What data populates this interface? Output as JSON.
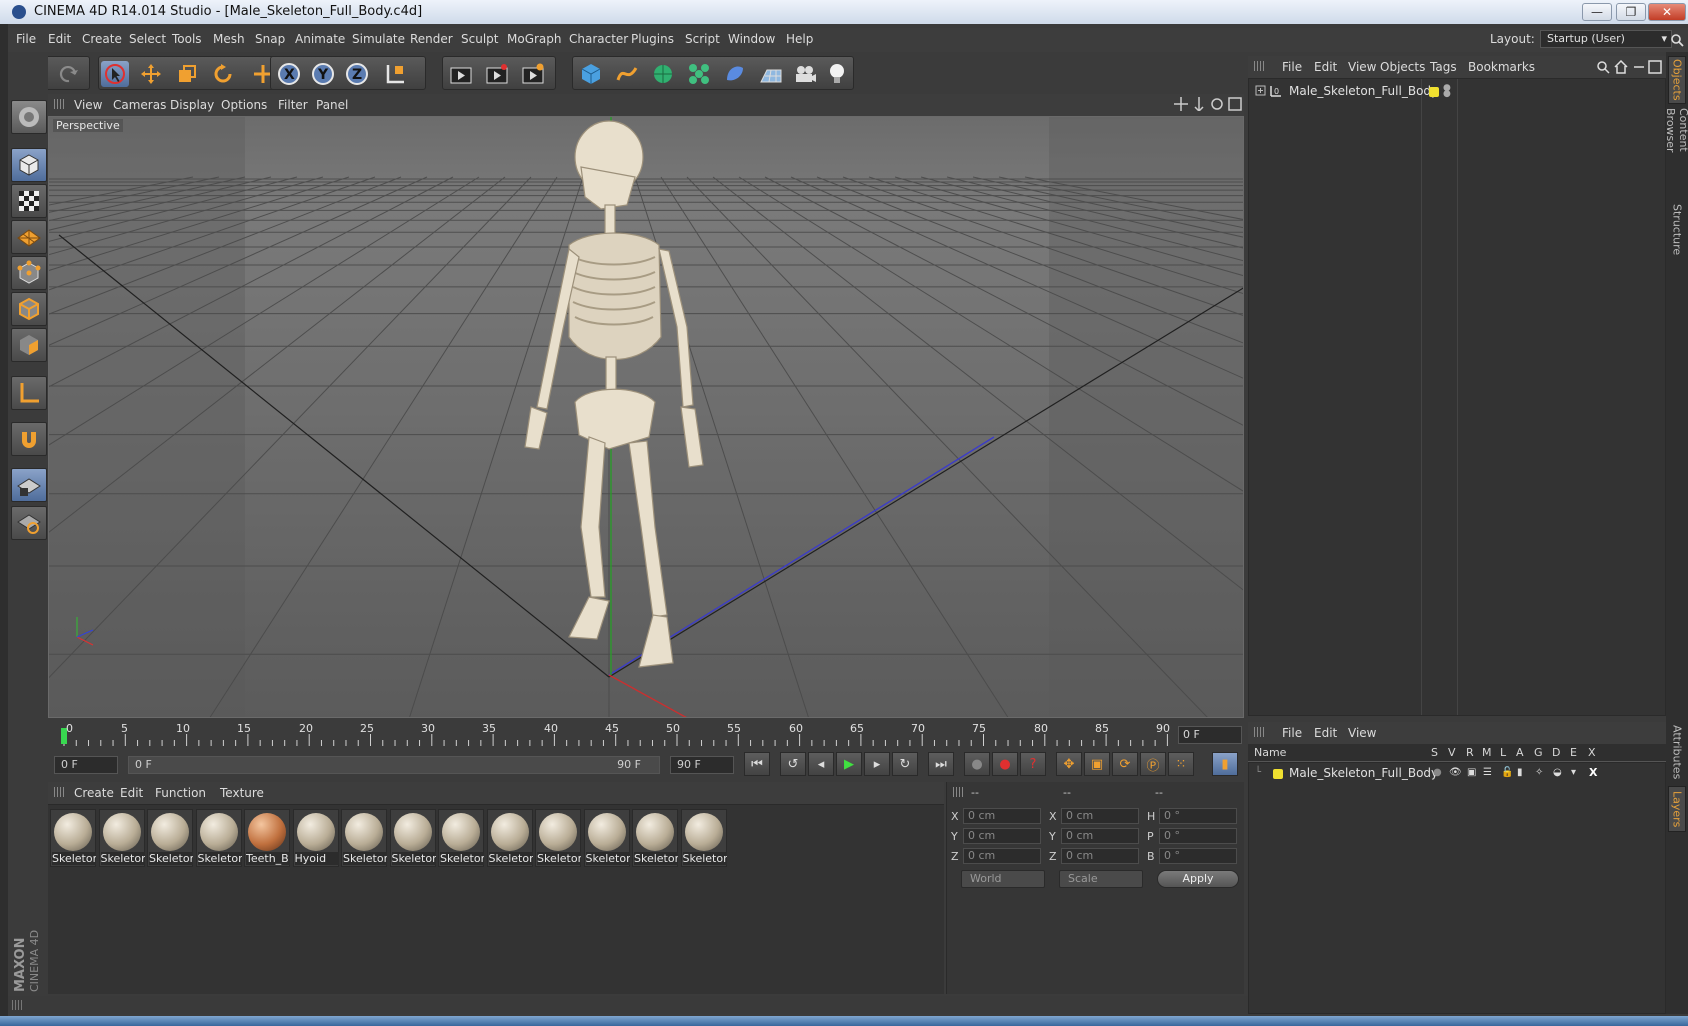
{
  "window": {
    "title": "CINEMA 4D R14.014 Studio - [Male_Skeleton_Full_Body.c4d]",
    "controls": [
      "—",
      "❐",
      "✕"
    ]
  },
  "menubar": {
    "items": [
      "File",
      "Edit",
      "Create",
      "Select",
      "Tools",
      "Mesh",
      "Snap",
      "Animate",
      "Simulate",
      "Render",
      "Sculpt",
      "MoGraph",
      "Character",
      "Plugins",
      "Script",
      "Window",
      "Help"
    ],
    "layout_label": "Layout:",
    "layout_value": "Startup (User)"
  },
  "viewport": {
    "menus": [
      "View",
      "Cameras",
      "Display",
      "Options",
      "Filter",
      "Panel"
    ],
    "camera_label": "Perspective"
  },
  "timeline": {
    "ticks": [
      "0",
      "5",
      "10",
      "15",
      "20",
      "25",
      "30",
      "35",
      "40",
      "45",
      "50",
      "55",
      "60",
      "65",
      "70",
      "75",
      "80",
      "85",
      "90"
    ],
    "current_frame": "0 F"
  },
  "transport": {
    "start_field": "0 F",
    "range_start": "0 F",
    "range_end": "90 F",
    "end_field": "90 F"
  },
  "materials": {
    "menus": [
      "Create",
      "Edit",
      "Function",
      "Texture"
    ],
    "items": [
      "Skeletor",
      "Skeletor",
      "Skeletor",
      "Skeletor",
      "Teeth_B",
      "Hyoid",
      "Skeletor",
      "Skeletor",
      "Skeletor",
      "Skeletor",
      "Skeletor",
      "Skeletor",
      "Skeletor",
      "Skeletor"
    ],
    "teeth_index": 4
  },
  "coordinates": {
    "headers": [
      "--",
      "--",
      "--"
    ],
    "rows": [
      {
        "a": "X",
        "av": "0 cm",
        "b": "X",
        "bv": "0 cm",
        "c": "H",
        "cv": "0 °"
      },
      {
        "a": "Y",
        "av": "0 cm",
        "b": "Y",
        "bv": "0 cm",
        "c": "P",
        "cv": "0 °"
      },
      {
        "a": "Z",
        "av": "0 cm",
        "b": "Z",
        "bv": "0 cm",
        "c": "B",
        "cv": "0 °"
      }
    ],
    "world": "World",
    "scale": "Scale",
    "apply": "Apply"
  },
  "objects": {
    "menus": [
      "File",
      "Edit",
      "View",
      "Objects",
      "Tags",
      "Bookmarks"
    ],
    "item": "Male_Skeleton_Full_Body",
    "layer_color": "#f0e030"
  },
  "layers": {
    "menus": [
      "File",
      "Edit",
      "View"
    ],
    "columns": [
      "Name",
      "S",
      "V",
      "R",
      "M",
      "L",
      "A",
      "G",
      "D",
      "E",
      "X"
    ],
    "item": "Male_Skeleton_Full_Body"
  },
  "right_tabs": [
    "Objects",
    "Content Browser",
    "Structure",
    "Attributes",
    "Layers"
  ],
  "branding": {
    "maxon": "MAXON",
    "product": "CINEMA 4D"
  },
  "colors": {
    "accent": "#e8a23a",
    "active_tool": "#5a7bb0",
    "axis_x": "#e03030",
    "axis_y": "#30c030",
    "axis_z": "#3040e0"
  }
}
